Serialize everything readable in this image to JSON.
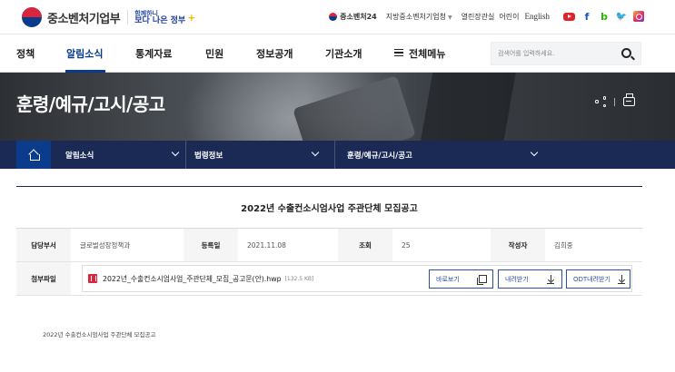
{
  "header": {
    "logo_text": "중소벤처기업부",
    "slogan_small": "함께하니",
    "slogan_big": "보다 나은 정부",
    "utility": {
      "sme24": "중소벤처24",
      "regional": "지방중소벤처기업청",
      "open_office": "열린장관실",
      "kids": "어린이",
      "english": "English"
    },
    "social_icons": [
      "youtube-icon",
      "facebook-icon",
      "blog-icon",
      "twitter-icon",
      "instagram-icon"
    ]
  },
  "gnb": {
    "items": [
      "정책",
      "알림소식",
      "통계자료",
      "민원",
      "정보공개",
      "기관소개"
    ],
    "all_menu": "전체메뉴",
    "active": "알림소식",
    "search_placeholder": "검색어를 입력하세요."
  },
  "banner": {
    "title": "훈령/예규/고시/공고"
  },
  "breadcrumb": {
    "level1": "알림소식",
    "level2": "법령정보",
    "level3": "훈령/예규/고시/공고"
  },
  "article": {
    "title": "2022년 수출컨소시엄사업 주관단체 모집공고",
    "labels": {
      "dept": "담당부서",
      "date": "등록일",
      "views": "조회",
      "author": "작성자",
      "attachment": "첨부파일"
    },
    "dept": "글로벌성장정책과",
    "date": "2021.11.08",
    "views": "25",
    "author": "김희중",
    "file": {
      "name": "2022년_수출컨소시엄사업_주관단체_모집_공고문(안).hwp",
      "size": "[132.5 KB]",
      "view_label": "바로보기",
      "download_label": "내려받기",
      "odt_label": "ODT내려받기"
    },
    "body": "2022년 수출컨소시엄사업 주관단체 모집공고"
  },
  "colors": {
    "brand_navy": "#0b3c8c",
    "breadcrumb_bg": "#1b2a54",
    "button_blue": "#2b4ea6"
  }
}
